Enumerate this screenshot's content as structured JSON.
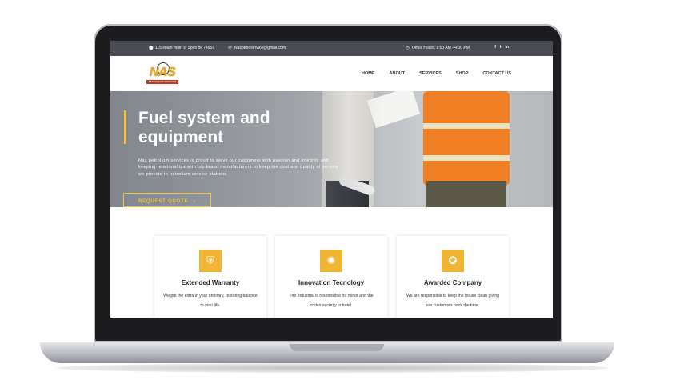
{
  "topbar": {
    "address": "115 south main st Spiro ok 74959",
    "email": "Naspetroservice@gmail.com",
    "hours": "Office Hours, 8:00 AM - 4:00 PM",
    "social": [
      "f",
      "t",
      "in"
    ]
  },
  "header": {
    "logo_text": "NAS",
    "logo_sub": "PETROLEUM SERVICES",
    "nav": [
      "HOME",
      "ABOUT",
      "SERVICES",
      "SHOP",
      "CONTACT US"
    ]
  },
  "hero": {
    "title": "Fuel system and equipment",
    "text": "Nas petrolium services is proud to serve our customers with passion and integrity and keeping relationships with top brand manufacturers to keep the cost and quality of service we provide to petrolium service stations.",
    "button_label": "REQUEST QUOTE",
    "button_arrow": "›",
    "accent_color": "#f2c230"
  },
  "features": [
    {
      "icon": "shield-icon",
      "glyph": "⛨",
      "title": "Extended Warranty",
      "text": "We put the extra in your ordinary, restoring balance to your life."
    },
    {
      "icon": "lightbulb-icon",
      "glyph": "✺",
      "title": "Innovation Tecnology",
      "text": "The Industrial is responsible for minor and the codes security in hotel."
    },
    {
      "icon": "award-icon",
      "glyph": "✪",
      "title": "Awarded Company",
      "text": "We are responsible to keep the house clean giving our customers back the time."
    }
  ]
}
